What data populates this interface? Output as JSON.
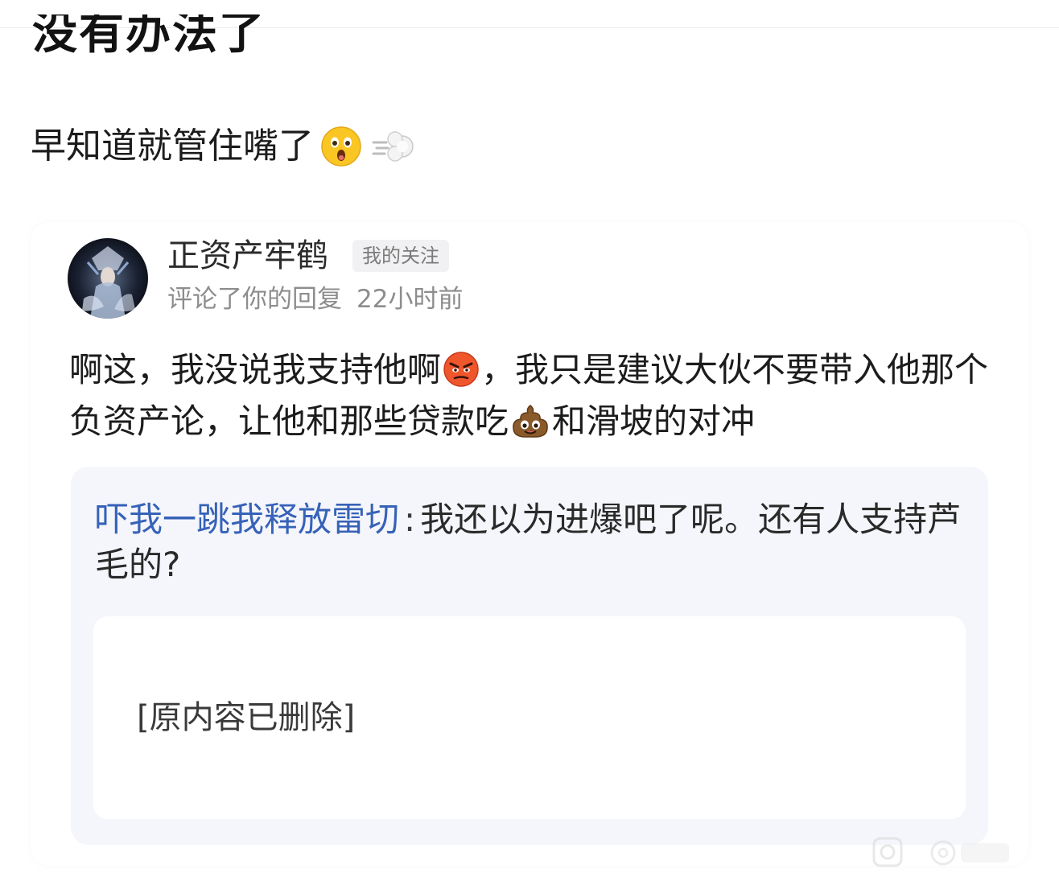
{
  "post": {
    "heading": "没有办法了",
    "subline": "早知道就管住嘴了"
  },
  "notification": {
    "username": "正资产牢鹤",
    "tag": "我的关注",
    "action": "评论了你的回复",
    "time": "22小时前",
    "comment_part1": "啊这，我没说我支持他啊",
    "comment_part2": "，我只是建议大伙不要带入他那个负资产论，让他和那些贷款吃",
    "comment_part3": "和滑坡的对冲",
    "quote_author": "吓我一跳我释放雷切",
    "quote_sep": ":",
    "quote_text": "我还以为进爆吧了呢。还有人支持芦毛的?",
    "deleted_notice": "[原内容已删除]"
  },
  "icons": {
    "shock": "astonished-face-icon",
    "puff": "dashing-away-icon",
    "angry": "angry-face-icon",
    "poop": "pile-of-poo-icon"
  },
  "colors": {
    "link_blue": "#3662b8",
    "quote_bg": "#f5f6fb",
    "meta_gray": "#8d8d8d"
  }
}
